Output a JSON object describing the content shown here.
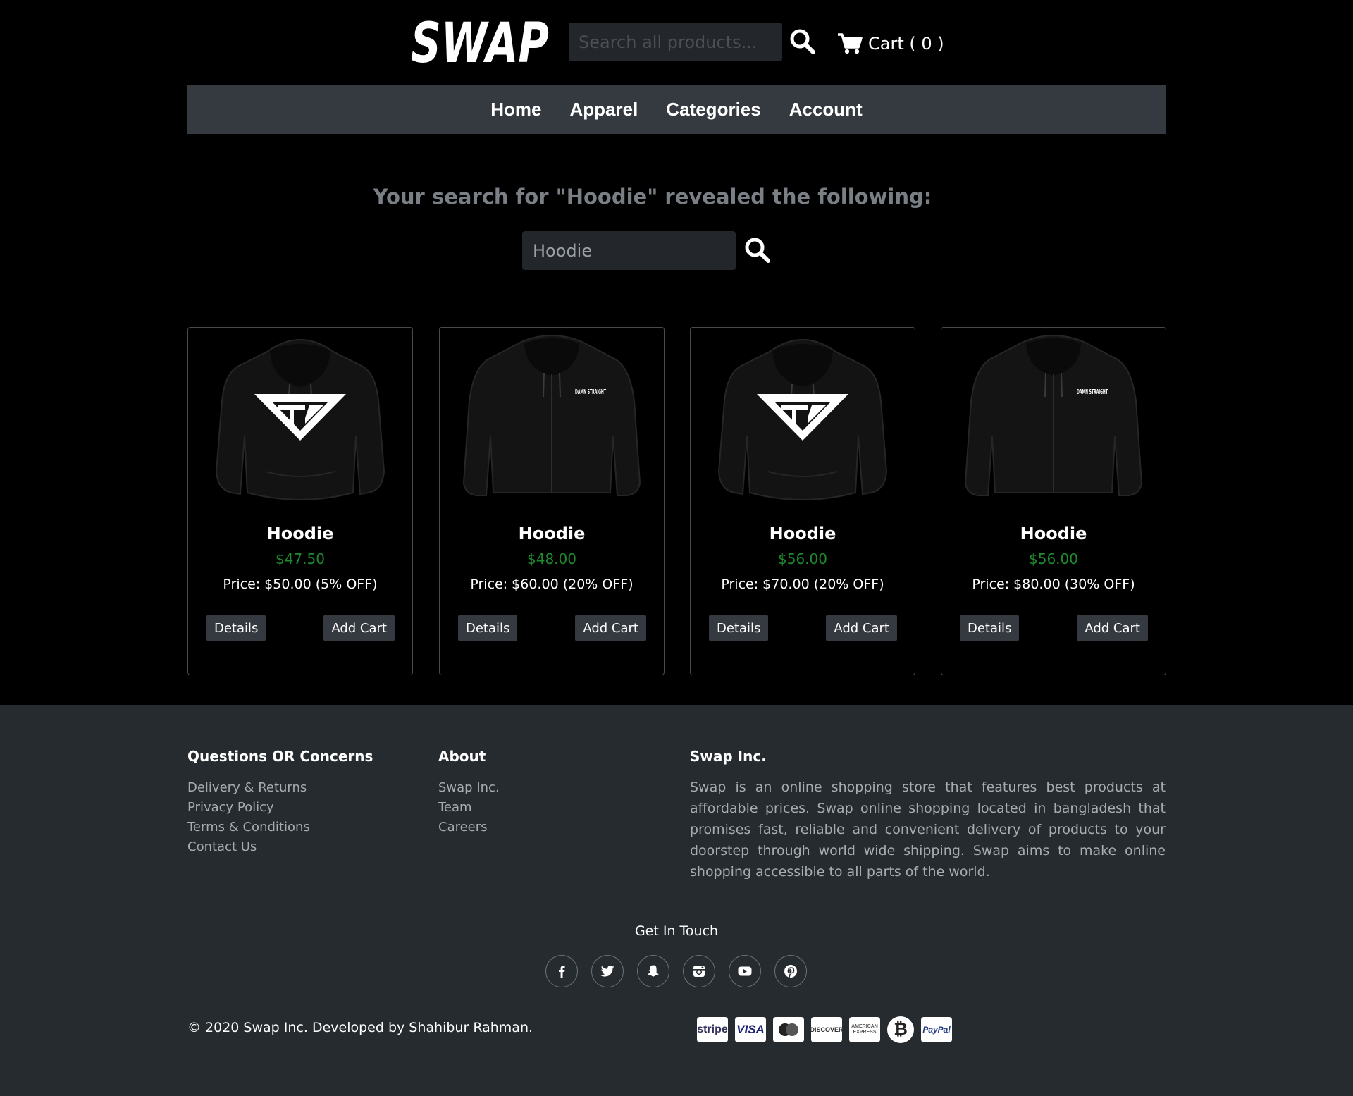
{
  "brand": {
    "logo_text": "SWAP"
  },
  "header": {
    "search_placeholder": "Search all products...",
    "search_icon": "search-icon",
    "cart_label": "Cart ( 0 )",
    "cart_icon": "cart-icon"
  },
  "nav": {
    "items": [
      "Home",
      "Apparel",
      "Categories",
      "Account"
    ]
  },
  "search": {
    "heading": "Your search for \"Hoodie\" revealed the following:",
    "value": "Hoodie"
  },
  "products": [
    {
      "name": "Hoodie",
      "price": "$47.50",
      "price_prefix": "Price:",
      "original": "$50.00",
      "discount": "(5% OFF)",
      "details": "Details",
      "add": "Add Cart",
      "image": "pullover-hoodie-triangle-logo"
    },
    {
      "name": "Hoodie",
      "price": "$48.00",
      "price_prefix": "Price:",
      "original": "$60.00",
      "discount": "(20% OFF)",
      "details": "Details",
      "add": "Add Cart",
      "image": "zip-hoodie-damn-straight",
      "print_text": "DAMN STRAIGHT"
    },
    {
      "name": "Hoodie",
      "price": "$56.00",
      "price_prefix": "Price:",
      "original": "$70.00",
      "discount": "(20% OFF)",
      "details": "Details",
      "add": "Add Cart",
      "image": "pullover-hoodie-triangle-logo"
    },
    {
      "name": "Hoodie",
      "price": "$56.00",
      "price_prefix": "Price:",
      "original": "$80.00",
      "discount": "(30% OFF)",
      "details": "Details",
      "add": "Add Cart",
      "image": "zip-hoodie-damn-straight",
      "print_text": "DAMN STRAIGHT"
    }
  ],
  "footer": {
    "col1": {
      "title": "Questions OR Concerns",
      "links": [
        "Delivery & Returns",
        "Privacy Policy",
        "Terms & Conditions",
        "Contact Us"
      ]
    },
    "col2": {
      "title": "About",
      "links": [
        "Swap Inc.",
        "Team",
        "Careers"
      ]
    },
    "col3": {
      "title": "Swap Inc.",
      "text": "Swap is an online shopping store that features best products at affordable prices. Swap online shopping located in bangladesh that promises fast, reliable and convenient delivery of products to your doorstep through world wide shipping. Swap aims to make online shopping accessible to all parts of the world."
    },
    "get_in_touch": "Get In Touch",
    "socials": [
      "facebook-icon",
      "twitter-icon",
      "snapchat-icon",
      "instagram-icon",
      "youtube-icon",
      "pinterest-icon"
    ],
    "copyright": "© 2020 Swap Inc. Developed by Shahibur Rahman.",
    "payments": [
      {
        "icon": "stripe-icon",
        "label": "stripe"
      },
      {
        "icon": "visa-icon",
        "label": "VISA"
      },
      {
        "icon": "mastercard-icon",
        "label": ""
      },
      {
        "icon": "discover-icon",
        "label": "DISCOVER"
      },
      {
        "icon": "amex-icon",
        "label": "AMERICAN EXPRESS"
      },
      {
        "icon": "bitcoin-icon",
        "label": "₿"
      },
      {
        "icon": "paypal-icon",
        "label": "PayPal"
      }
    ]
  },
  "colors": {
    "background": "#000000",
    "nav": "#343a40",
    "footer": "#262b2f",
    "price": "#1f8a2e",
    "muted_text": "#a7acb1"
  }
}
